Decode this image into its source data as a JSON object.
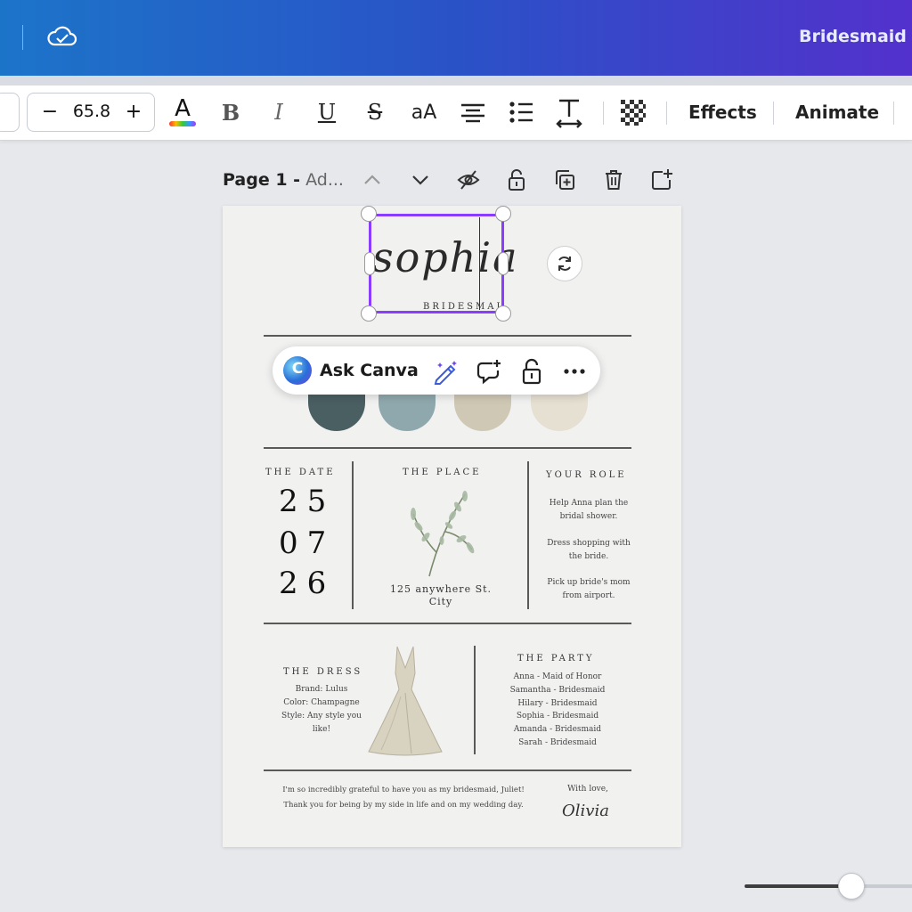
{
  "header": {
    "doc_title": "Bridesmaid I"
  },
  "toolbar": {
    "font_size": "65.8",
    "minus": "−",
    "plus": "+",
    "text_color_letter": "A",
    "bold": "B",
    "italic": "I",
    "underline": "U",
    "strike": "S",
    "case": "aA",
    "effects": "Effects",
    "animate": "Animate"
  },
  "page_header": {
    "page_name": "Page 1 -",
    "page_subtitle": "Ad..."
  },
  "design": {
    "name_script": "sophia",
    "bridesmaid_caption": "BRIDESMAID",
    "palette": [
      "#4a5f62",
      "#8fa8ad",
      "#cfc8b5",
      "#e6e0d2"
    ],
    "date": {
      "heading": "THE DATE",
      "day": "25",
      "month": "07",
      "year": "26"
    },
    "place": {
      "heading": "THE PLACE",
      "address_line1": "125 anywhere St.",
      "address_line2": "City"
    },
    "role": {
      "heading": "YOUR ROLE",
      "items": [
        [
          "Help Anna plan the",
          "bridal shower."
        ],
        [
          "Dress shopping with",
          "the bride."
        ],
        [
          "Pick up bride's mom",
          "from airport."
        ]
      ]
    },
    "dress": {
      "heading": "THE DRESS",
      "lines": [
        "Brand: Lulus",
        "Color: Champagne",
        "Style: Any style you",
        "like!"
      ]
    },
    "party": {
      "heading": "THE PARTY",
      "members": [
        "Anna - Maid of Honor",
        "Samantha - Bridesmaid",
        "Hilary - Bridesmaid",
        "Sophia - Bridesmaid",
        "Amanda - Bridesmaid",
        "Sarah - Bridesmaid"
      ]
    },
    "note": {
      "line1": "I'm so incredibly grateful to have you as my bridesmaid, Juliet!",
      "line2": "Thank you for being by my side in life and on my wedding day.",
      "signoff": "With love,",
      "signature": "Olivia"
    }
  },
  "ask_canva": {
    "label": "Ask Canva",
    "logo_letter": "C"
  },
  "colors": {
    "accent": "#8b3dff",
    "header_start": "#1c74c9",
    "header_end": "#5331cc"
  }
}
